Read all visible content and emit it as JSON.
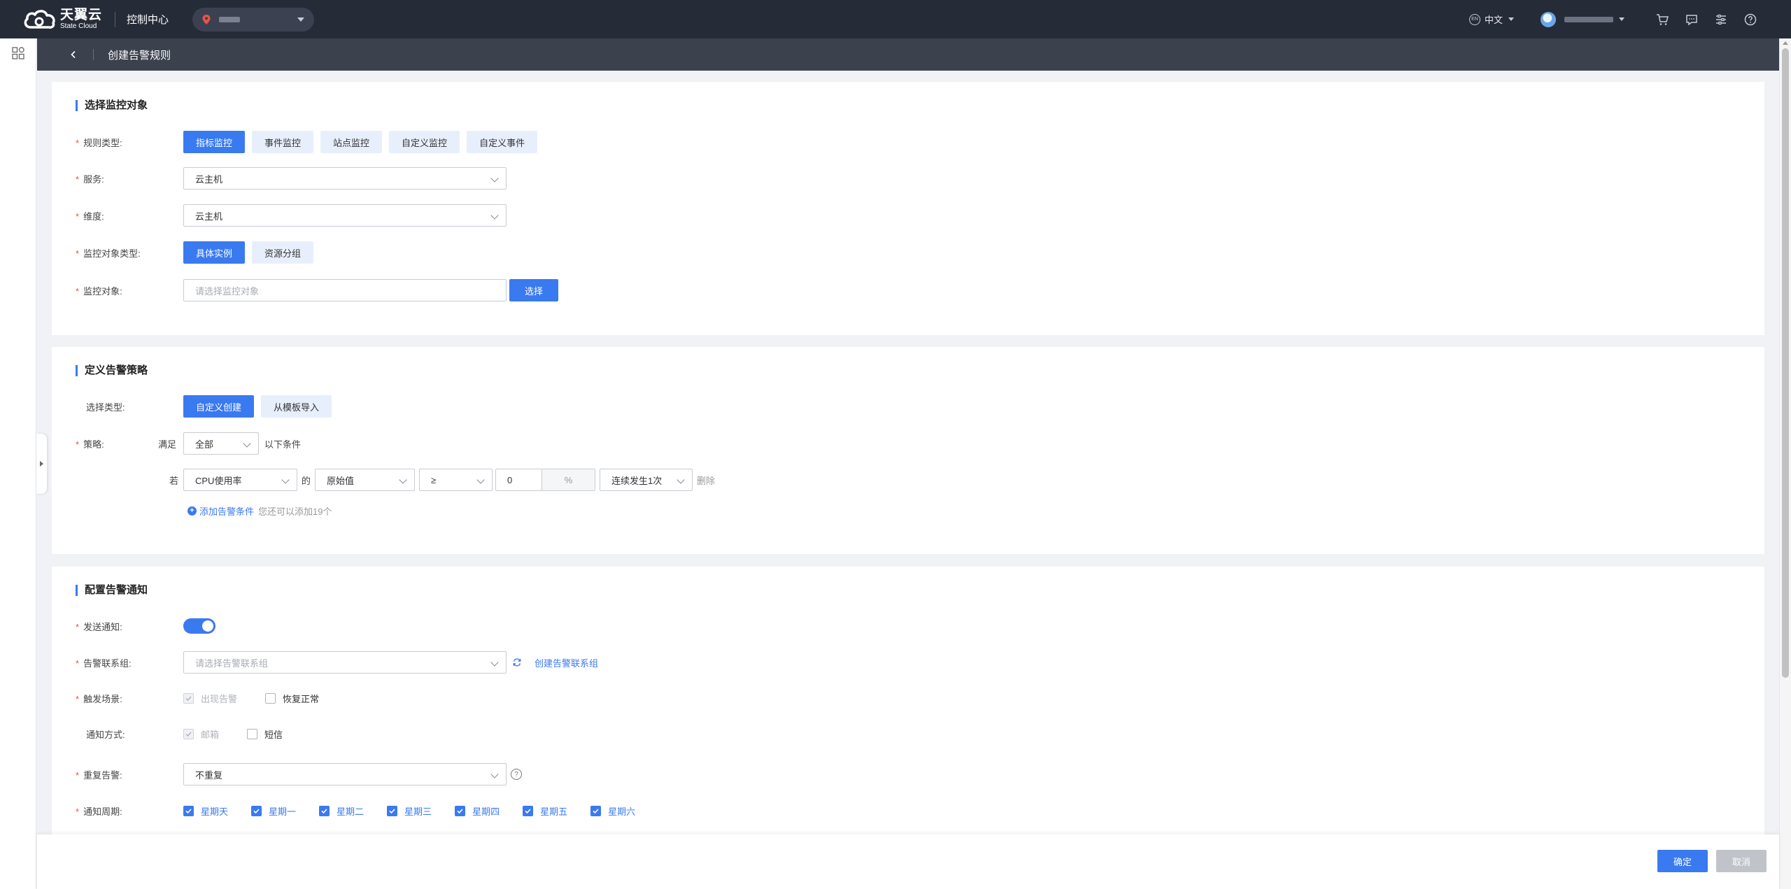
{
  "topbar": {
    "logo_cn": "天翼云",
    "logo_en": "State Cloud",
    "console_title": "控制中心",
    "lang": "中文",
    "lang_icon": "EN"
  },
  "breadcrumb": {
    "page_title": "创建告警规则"
  },
  "section1": {
    "title": "选择监控对象",
    "rule_type_label": "规则类型:",
    "rule_types": [
      "指标监控",
      "事件监控",
      "站点监控",
      "自定义监控",
      "自定义事件"
    ],
    "service_label": "服务:",
    "service_value": "云主机",
    "dimension_label": "维度:",
    "dimension_value": "云主机",
    "object_type_label": "监控对象类型:",
    "object_types": [
      "具体实例",
      "资源分组"
    ],
    "object_label": "监控对象:",
    "object_placeholder": "请选择监控对象",
    "select_button": "选择"
  },
  "section2": {
    "title": "定义告警策略",
    "select_type_label": "选择类型:",
    "select_types": [
      "自定义创建",
      "从模板导入"
    ],
    "strategy_label": "策略:",
    "satisfy_text": "满足",
    "satisfy_value": "全部",
    "condition_suffix": "以下条件",
    "if_text": "若",
    "metric_value": "CPU使用率",
    "of_text": "的",
    "stat_value": "原始值",
    "operator_value": "≥",
    "threshold_value": "0",
    "threshold_unit": "%",
    "duration_value": "连续发生1次",
    "delete_text": "删除",
    "add_condition": "添加告警条件",
    "add_hint": "您还可以添加19个"
  },
  "section3": {
    "title": "配置告警通知",
    "notify_label": "发送通知:",
    "notify_on": true,
    "contact_label": "告警联系组:",
    "contact_placeholder": "请选择告警联系组",
    "create_contact": "创建告警联系组",
    "scene_label": "触发场景:",
    "scene_alarm": "出现告警",
    "scene_recover": "恢复正常",
    "method_label": "通知方式:",
    "method_email": "邮箱",
    "method_sms": "短信",
    "repeat_label": "重复告警:",
    "repeat_value": "不重复",
    "period_label": "通知周期:",
    "weekdays": [
      "星期天",
      "星期一",
      "星期二",
      "星期三",
      "星期四",
      "星期五",
      "星期六"
    ]
  },
  "footer": {
    "ok": "确定",
    "cancel": "取消"
  },
  "colors": {
    "primary": "#3a7af0",
    "topbar": "#262b38",
    "subbar": "#3c414e",
    "required": "#f0504a"
  }
}
